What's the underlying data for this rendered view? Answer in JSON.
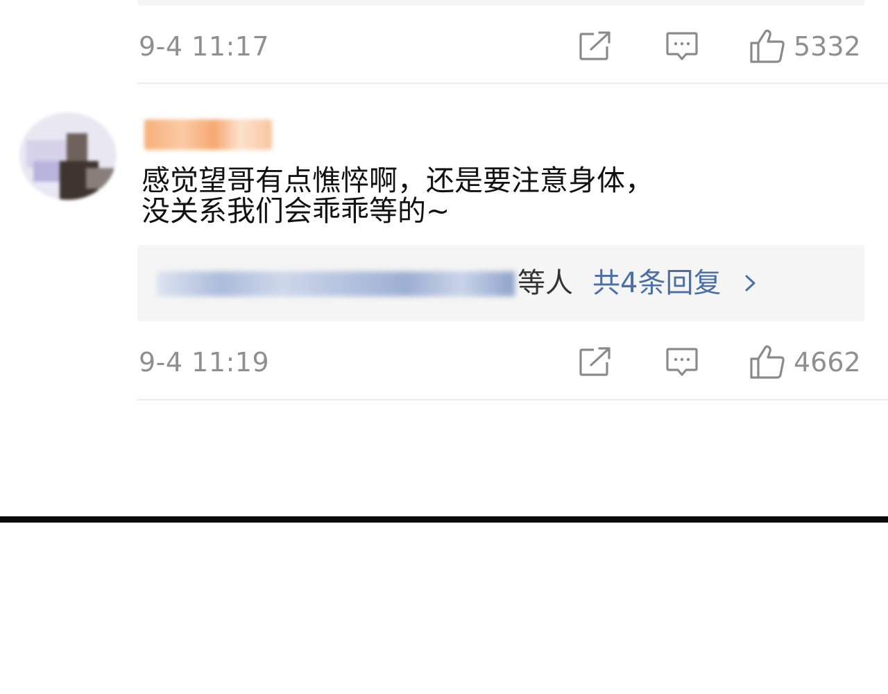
{
  "previous_comment": {
    "timestamp": "9-4 11:17",
    "like_count": "5332"
  },
  "comment": {
    "text_line1": "感觉望哥有点憔悴啊，还是要注意身体，",
    "text_line2": "没关系我们会乖乖等的~",
    "replies": {
      "suffix": "等人",
      "count_label": "共4条回复"
    },
    "timestamp": "9-4 11:19",
    "like_count": "4662"
  },
  "icons": {
    "share": "share-icon",
    "comment": "comment-icon",
    "like": "thumbs-up-icon",
    "chevron": "chevron-right-icon"
  },
  "colors": {
    "meta_gray": "#8f8f8f",
    "link_blue": "#4a6ea8",
    "reply_bg": "#f5f5f5"
  }
}
